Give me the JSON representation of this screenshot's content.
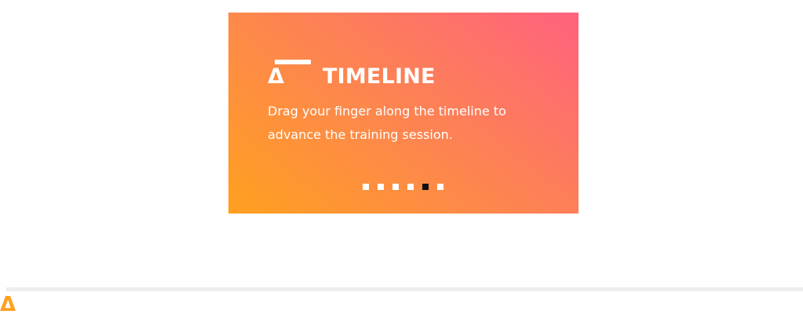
{
  "card": {
    "logo_glyph": "Δ",
    "title": "TIMELINE",
    "description": "Drag your finger along the timeline to advance the training session.",
    "pagination": {
      "total": 6,
      "active_index": 4
    }
  },
  "footer": {
    "logo_glyph": "Δ"
  },
  "colors": {
    "gradient_start": "#ffa01f",
    "gradient_end": "#ff627e",
    "dot_inactive": "#ffffff",
    "dot_active": "#111111",
    "brand_orange": "#ffa01f"
  }
}
